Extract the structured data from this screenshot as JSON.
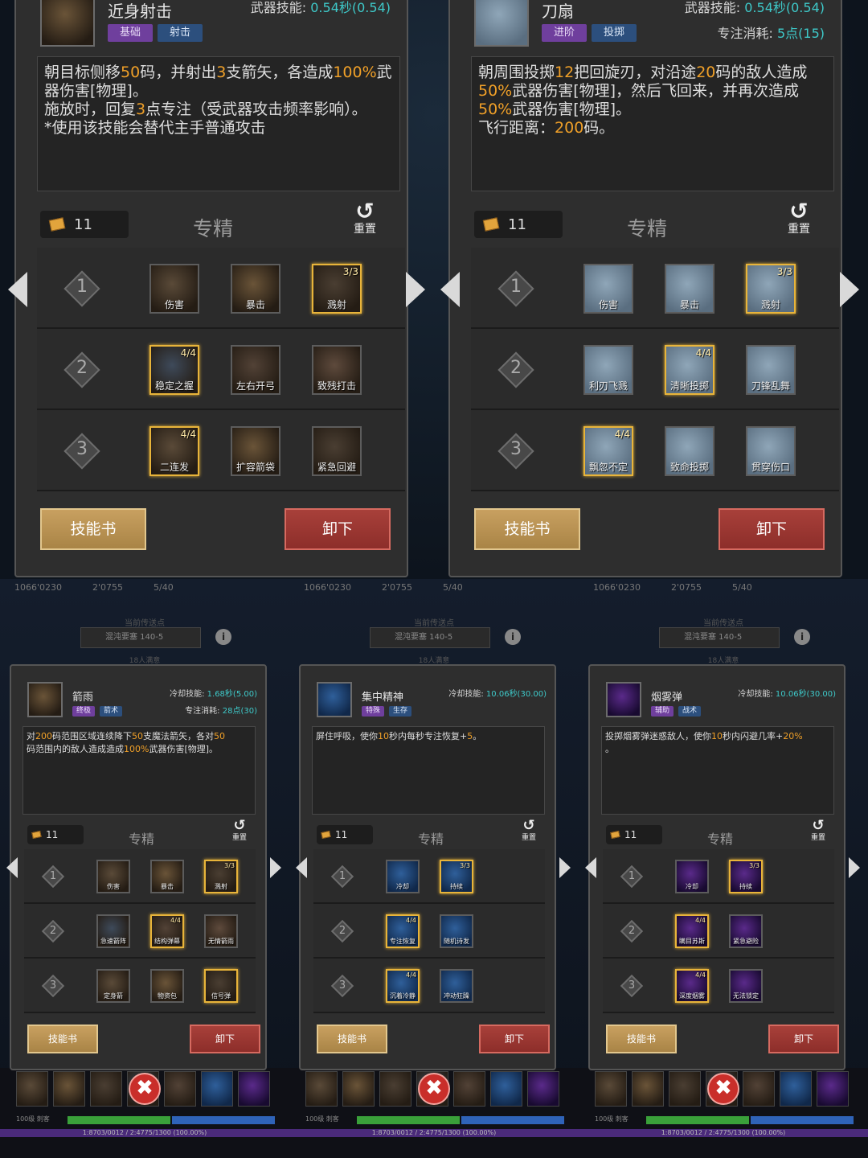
{
  "top_panels": [
    {
      "name": "近身射击",
      "tags": [
        "基础",
        "射击"
      ],
      "stat1_label": "武器技能: ",
      "stat1_value": "0.54",
      "stat1_suffix": "秒(0.54)",
      "stat2": "",
      "desc": [
        [
          "t",
          "朝目标侧移"
        ],
        [
          "o",
          "50"
        ],
        [
          "t",
          "码，并射出"
        ],
        [
          "o",
          "3"
        ],
        [
          "t",
          "支箭矢，各造成"
        ],
        [
          "o",
          "100%"
        ],
        [
          "t",
          "武器伤害[物理]。"
        ],
        [
          "br",
          ""
        ],
        [
          "t",
          "施放时，回复"
        ],
        [
          "o",
          "3"
        ],
        [
          "t",
          "点专注（受武器攻击频率影响）。"
        ],
        [
          "br",
          ""
        ],
        [
          "t",
          "*使用该技能会替代主手普通攻击"
        ]
      ],
      "points": "11",
      "spec": "专精",
      "reset": "重置",
      "rows": [
        {
          "num": "1",
          "slots": [
            {
              "label": "伤害",
              "rank": "",
              "gold": false
            },
            {
              "label": "暴击",
              "rank": "",
              "gold": false
            },
            {
              "label": "溅射",
              "rank": "3/3",
              "gold": true
            }
          ]
        },
        {
          "num": "2",
          "slots": [
            {
              "label": "稳定之握",
              "rank": "4/4",
              "gold": true
            },
            {
              "label": "左右开弓",
              "rank": "",
              "gold": false
            },
            {
              "label": "致残打击",
              "rank": "",
              "gold": false
            }
          ]
        },
        {
          "num": "3",
          "slots": [
            {
              "label": "二连发",
              "rank": "4/4",
              "gold": true
            },
            {
              "label": "扩容箭袋",
              "rank": "",
              "gold": false
            },
            {
              "label": "紧急回避",
              "rank": "",
              "gold": false
            }
          ]
        }
      ],
      "btn_book": "技能书",
      "btn_unequip": "卸下"
    },
    {
      "name": "刀扇",
      "tags": [
        "进阶",
        "投掷"
      ],
      "stat1_label": "武器技能: ",
      "stat1_value": "0.54",
      "stat1_suffix": "秒(0.54)",
      "stat2_label": "专注消耗: ",
      "stat2_value": "5",
      "stat2_suffix": "点(15)",
      "desc": [
        [
          "t",
          "朝周围投掷"
        ],
        [
          "o",
          "12"
        ],
        [
          "t",
          "把回旋刃，对沿途"
        ],
        [
          "o",
          "20"
        ],
        [
          "t",
          "码的敌人造成"
        ],
        [
          "br",
          ""
        ],
        [
          "o",
          "50%"
        ],
        [
          "t",
          "武器伤害[物理]，然后飞回来，并再次造成"
        ],
        [
          "br",
          ""
        ],
        [
          "o",
          "50%"
        ],
        [
          "t",
          "武器伤害[物理]。"
        ],
        [
          "br",
          ""
        ],
        [
          "t",
          "飞行距离："
        ],
        [
          "o",
          "200"
        ],
        [
          "t",
          "码。"
        ]
      ],
      "points": "11",
      "spec": "专精",
      "reset": "重置",
      "rows": [
        {
          "num": "1",
          "slots": [
            {
              "label": "伤害",
              "rank": "",
              "gold": false
            },
            {
              "label": "暴击",
              "rank": "",
              "gold": false
            },
            {
              "label": "溅射",
              "rank": "3/3",
              "gold": true
            }
          ]
        },
        {
          "num": "2",
          "slots": [
            {
              "label": "利刃飞溅",
              "rank": "",
              "gold": false
            },
            {
              "label": "清晰投掷",
              "rank": "4/4",
              "gold": true
            },
            {
              "label": "刀锋乱舞",
              "rank": "",
              "gold": false
            }
          ]
        },
        {
          "num": "3",
          "slots": [
            {
              "label": "飘忽不定",
              "rank": "4/4",
              "gold": true
            },
            {
              "label": "致命投掷",
              "rank": "",
              "gold": false
            },
            {
              "label": "贯穿伤口",
              "rank": "",
              "gold": false
            }
          ]
        }
      ],
      "btn_book": "技能书",
      "btn_unequip": "卸下"
    }
  ],
  "bottom_panels": [
    {
      "topbar": [
        "1066'0230",
        "2'0755",
        "5/40"
      ],
      "location_title": "当前传送点",
      "location": "混沌要塞 140-5",
      "sub": "18人满意",
      "name": "箭雨",
      "tags": [
        "终极",
        "箭术"
      ],
      "stat1_label": "冷却技能: ",
      "stat1_value": "1.68",
      "stat1_suffix": "秒(5.00)",
      "stat2_label": "专注消耗: ",
      "stat2_value": "28",
      "stat2_suffix": "点(30)",
      "desc": [
        [
          "t",
          "对"
        ],
        [
          "o",
          "200"
        ],
        [
          "t",
          "码范围区域连续降下"
        ],
        [
          "o",
          "50"
        ],
        [
          "t",
          "支魔法箭矢，各对"
        ],
        [
          "o",
          "50"
        ],
        [
          "br",
          ""
        ],
        [
          "t",
          "码范围内的敌人造成造成"
        ],
        [
          "o",
          "100%"
        ],
        [
          "t",
          "武器伤害[物理]。"
        ]
      ],
      "points": "11",
      "spec": "专精",
      "reset": "重置",
      "rows": [
        {
          "num": "1",
          "slots": [
            {
              "label": "伤害",
              "rank": "",
              "gold": false
            },
            {
              "label": "暴击",
              "rank": "",
              "gold": false
            },
            {
              "label": "溅射",
              "rank": "3/3",
              "gold": true
            }
          ]
        },
        {
          "num": "2",
          "slots": [
            {
              "label": "急速箭阵",
              "rank": "",
              "gold": false
            },
            {
              "label": "结构弹幕",
              "rank": "4/4",
              "gold": true
            },
            {
              "label": "无情箭雨",
              "rank": "",
              "gold": false
            }
          ]
        },
        {
          "num": "3",
          "slots": [
            {
              "label": "定身箭",
              "rank": "",
              "gold": false
            },
            {
              "label": "物资包",
              "rank": "",
              "gold": false
            },
            {
              "label": "信号弹",
              "rank": "",
              "gold": true
            }
          ]
        }
      ],
      "btn_book": "技能书",
      "btn_unequip": "卸下",
      "xp": "1:8703/0012 / 2:4775/1300 (100.00%)",
      "lvl": "100级 刺客"
    },
    {
      "topbar": [
        "1066'0230",
        "2'0755",
        "5/40"
      ],
      "location_title": "当前传送点",
      "location": "混沌要塞 140-5",
      "sub": "18人满意",
      "name": "集中精神",
      "tags": [
        "特殊",
        "生存"
      ],
      "stat1_label": "冷却技能: ",
      "stat1_value": "10.06",
      "stat1_suffix": "秒(30.00)",
      "stat2": "",
      "desc": [
        [
          "t",
          "屏住呼吸，使你"
        ],
        [
          "o",
          "10"
        ],
        [
          "t",
          "秒内每秒专注恢复+"
        ],
        [
          "o",
          "5"
        ],
        [
          "t",
          "。"
        ]
      ],
      "points": "11",
      "spec": "专精",
      "reset": "重置",
      "rows": [
        {
          "num": "1",
          "slots": [
            {
              "label": "冷却",
              "rank": "",
              "gold": false
            },
            {
              "label": "持续",
              "rank": "3/3",
              "gold": true
            }
          ]
        },
        {
          "num": "2",
          "slots": [
            {
              "label": "专注恢复",
              "rank": "4/4",
              "gold": true
            },
            {
              "label": "随机诗发",
              "rank": "",
              "gold": false
            }
          ]
        },
        {
          "num": "3",
          "slots": [
            {
              "label": "沉着冷静",
              "rank": "4/4",
              "gold": true
            },
            {
              "label": "冲动狂躁",
              "rank": "",
              "gold": false
            }
          ]
        }
      ],
      "btn_book": "技能书",
      "btn_unequip": "卸下",
      "xp": "1:8703/0012 / 2:4775/1300 (100.00%)",
      "lvl": "100级 刺客"
    },
    {
      "topbar": [
        "1066'0230",
        "2'0755",
        "5/40"
      ],
      "location_title": "当前传送点",
      "location": "混沌要塞 140-5",
      "sub": "18人满意",
      "name": "烟雾弹",
      "tags": [
        "辅助",
        "战术"
      ],
      "stat1_label": "冷却技能: ",
      "stat1_value": "10.06",
      "stat1_suffix": "秒(30.00)",
      "stat2": "",
      "desc": [
        [
          "t",
          "投掷烟雾弹迷惑敌人，使你"
        ],
        [
          "o",
          "10"
        ],
        [
          "t",
          "秒内闪避几率+"
        ],
        [
          "o",
          "20%"
        ],
        [
          "br",
          ""
        ],
        [
          "t",
          "。"
        ]
      ],
      "points": "11",
      "spec": "专精",
      "reset": "重置",
      "rows": [
        {
          "num": "1",
          "slots": [
            {
              "label": "冷却",
              "rank": "",
              "gold": false
            },
            {
              "label": "持续",
              "rank": "3/3",
              "gold": true
            }
          ]
        },
        {
          "num": "2",
          "slots": [
            {
              "label": "瞒目苏斯",
              "rank": "4/4",
              "gold": true
            },
            {
              "label": "紧急避险",
              "rank": "",
              "gold": false
            }
          ]
        },
        {
          "num": "3",
          "slots": [
            {
              "label": "深度烟雾",
              "rank": "4/4",
              "gold": true
            },
            {
              "label": "无法锁定",
              "rank": "",
              "gold": false
            }
          ]
        }
      ],
      "btn_book": "技能书",
      "btn_unequip": "卸下",
      "xp": "1:8703/0012 / 2:4775/1300 (100.00%)",
      "lvl": "100级 刺客"
    }
  ],
  "colors": {
    "gold": "#e8b43a",
    "highlight": "#f0a028",
    "cyan": "#3ec9c9",
    "tag_purple": "#6f3f9d",
    "tag_blue": "#2c4f7d",
    "btn_gold": "#b8904e",
    "btn_red": "#9a3630"
  }
}
